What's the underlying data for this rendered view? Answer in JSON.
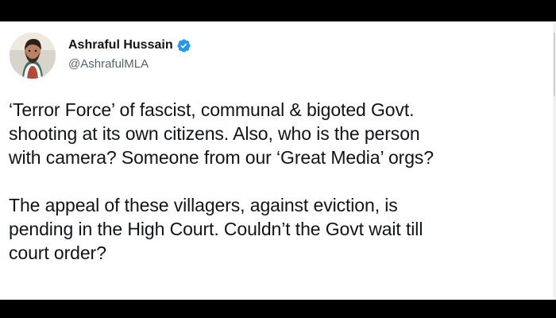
{
  "tweet": {
    "author": {
      "display_name": "Ashraful Hussain",
      "handle": "@AshrafulMLA",
      "verified": true,
      "verified_badge_icon": "verified-badge-icon",
      "avatar_icon": "profile-photo"
    },
    "text_paragraphs": [
      "‘Terror Force’ of fascist, communal & bigoted Govt.\nshooting at its own citizens. Also, who is the person\nwith camera? Someone from our ‘Great Media’ orgs?",
      "The appeal of these villagers, against eviction, is\npending in the High Court. Couldn’t the Govt wait till\ncourt order?"
    ]
  },
  "colors": {
    "background_bars": "#000000",
    "card_background": "#ffffff",
    "text_primary": "#0f1419",
    "text_secondary": "#536471",
    "verified_blue": "#1d9bf0"
  }
}
